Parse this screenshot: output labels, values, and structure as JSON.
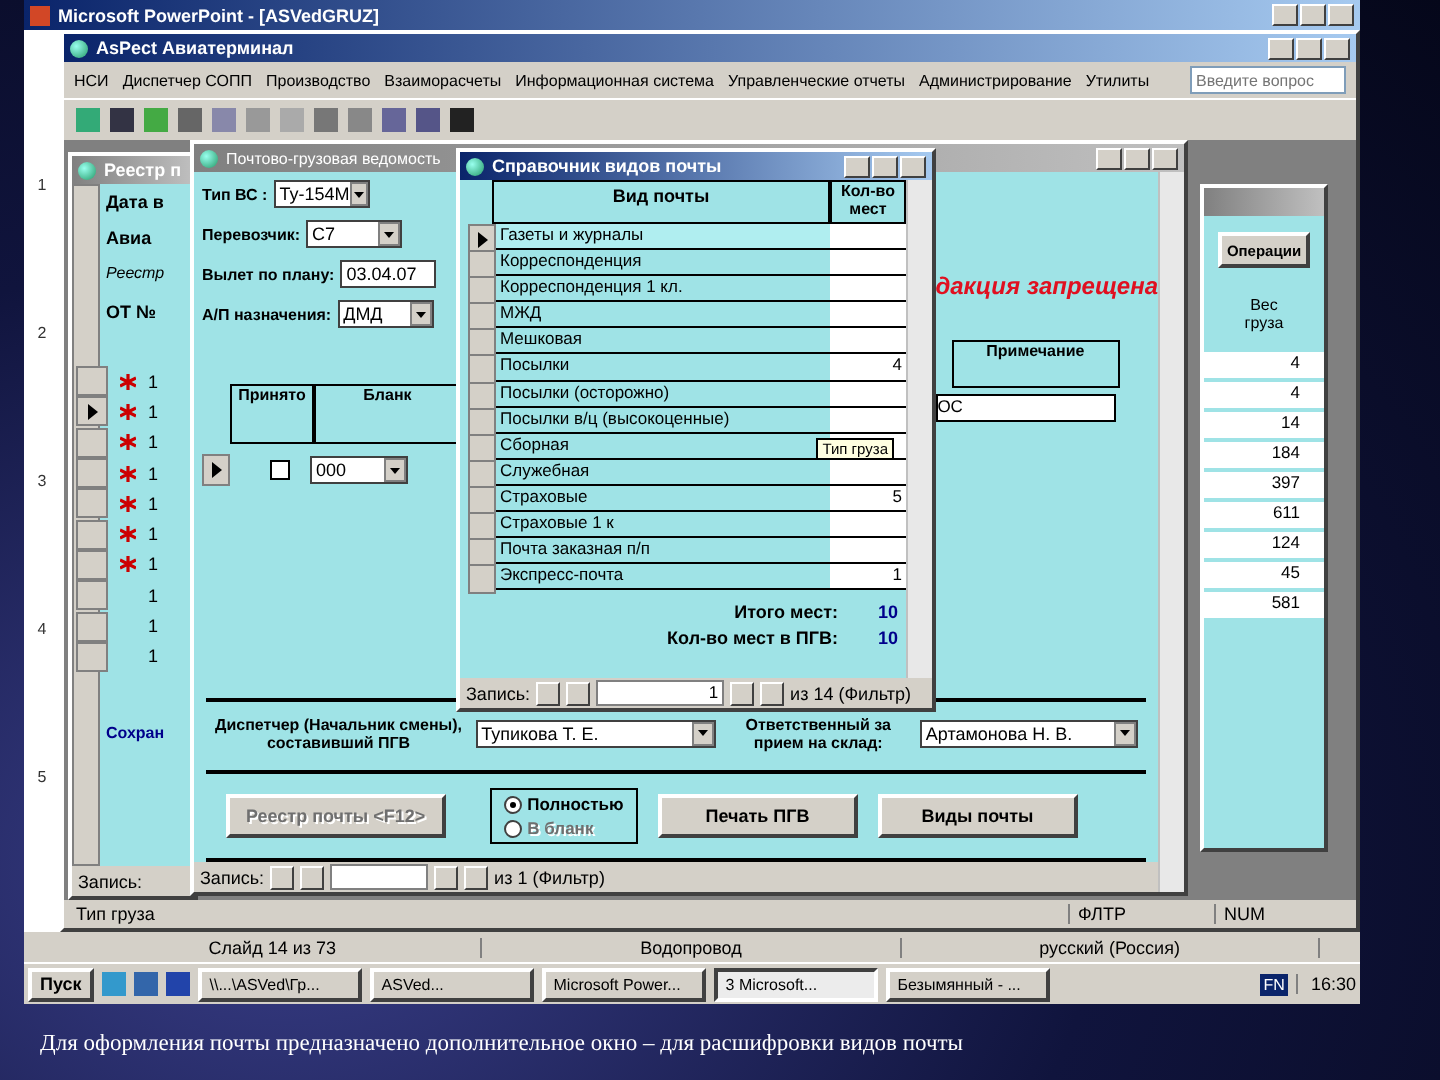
{
  "pp_window": {
    "title": "Microsoft PowerPoint - [ASVedGRUZ]"
  },
  "ruler": [
    "1",
    "2",
    "3",
    "4",
    "5"
  ],
  "app": {
    "title": "AsPect Авиатерминал",
    "menu": [
      "НСИ",
      "Диспетчер СОПП",
      "Производство",
      "Взаиморасчеты",
      "Информационная система",
      "Управленческие отчеты",
      "Администрирование",
      "Утилиты"
    ],
    "help_placeholder": "Введите вопрос"
  },
  "registry": {
    "title": "Реестр п",
    "labels": [
      "Дата в",
      "Авиа",
      "Реестр"
    ],
    "column": "ОТ №",
    "rows": [
      {
        "value": "1",
        "new": true,
        "selected": false
      },
      {
        "value": "1",
        "new": true,
        "selected": true
      },
      {
        "value": "1",
        "new": true,
        "selected": false
      },
      {
        "value": "1",
        "new": true,
        "selected": false
      },
      {
        "value": "1",
        "new": true,
        "selected": false
      },
      {
        "value": "1",
        "new": true,
        "selected": false
      },
      {
        "value": "1",
        "new": true,
        "selected": false
      },
      {
        "value": "1",
        "new": false,
        "selected": false
      },
      {
        "value": "1",
        "new": false,
        "selected": false
      },
      {
        "value": "1",
        "new": false,
        "selected": false
      }
    ],
    "link": "Сохран",
    "nav_label": "Запись:"
  },
  "statement": {
    "title": "Почтово-грузовая ведомость",
    "fields": [
      {
        "label": "Тип ВС :",
        "value": "Ту-154М"
      },
      {
        "label": "Перевозчик:",
        "value": "С7"
      },
      {
        "label": "Вылет по плану:",
        "value": "03.04.07"
      },
      {
        "label": "А/П назначения:",
        "value": "ДМД"
      }
    ],
    "warning": "дакция запрещена",
    "columns": [
      "Принято",
      "Бланк",
      "Примечание"
    ],
    "row": {
      "accepted": false,
      "blank": "000",
      "note": "ОС"
    },
    "dispatcher_label": "Диспетчер (Начальник смены), составивший ПГВ",
    "dispatcher": "Тупикова Т. Е.",
    "receiver_label": "Ответственный за прием на склад:",
    "receiver": "Артамонова Н. В.",
    "buttons": [
      {
        "label": "Реестр почты <F12>",
        "disabled": true
      },
      {
        "label": "Печать ПГВ",
        "disabled": false
      },
      {
        "label": "Виды почты",
        "disabled": false
      }
    ],
    "print_options": [
      {
        "label": "Полностью",
        "selected": true,
        "disabled": false
      },
      {
        "label": "В бланк",
        "selected": false,
        "disabled": true
      }
    ],
    "nav": {
      "label": "Запись:",
      "total": "из 1 (Фильтр)"
    }
  },
  "mail_types": {
    "title": "Справочник видов почты",
    "columns": [
      "Вид почты",
      "Кол-во мест"
    ],
    "rows": [
      {
        "name": "Газеты и журналы",
        "count": "",
        "selected": true
      },
      {
        "name": "Корреспонденция",
        "count": "",
        "selected": false
      },
      {
        "name": "Корреспонденция 1 кл.",
        "count": "",
        "selected": false
      },
      {
        "name": "МЖД",
        "count": "",
        "selected": false
      },
      {
        "name": "Мешковая",
        "count": "",
        "selected": false
      },
      {
        "name": "Посылки",
        "count": "4",
        "selected": false
      },
      {
        "name": "Посылки (осторожно)",
        "count": "",
        "selected": false
      },
      {
        "name": "Посылки в/ц (высокоценные)",
        "count": "",
        "selected": false
      },
      {
        "name": "Сборная",
        "count": "",
        "selected": false
      },
      {
        "name": "Служебная",
        "count": "",
        "selected": false
      },
      {
        "name": "Страховые",
        "count": "5",
        "selected": false
      },
      {
        "name": "Страховые 1 к",
        "count": "",
        "selected": false
      },
      {
        "name": "Почта заказная п/п",
        "count": "",
        "selected": false
      },
      {
        "name": "Экспресс-почта",
        "count": "1",
        "selected": false
      }
    ],
    "tooltip": "Тип груза",
    "total_label": "Итого мест:",
    "total": "10",
    "ved_label": "Кол-во мест в ПГВ:",
    "ved_total": "10",
    "nav": {
      "label": "Запись:",
      "value": "1",
      "total": "из 14 (Фильтр)"
    }
  },
  "ops": {
    "button": "Операции",
    "column": "Вес груза",
    "values": [
      "4",
      "4",
      "14",
      "184",
      "397",
      "611",
      "124",
      "45",
      "581"
    ]
  },
  "status_bar": {
    "text": "Тип груза",
    "indicators": [
      "ФЛТР",
      "NUM"
    ]
  },
  "pp_status": [
    "Слайд 14 из 73",
    "Водопровод",
    "русский (Россия)"
  ],
  "taskbar": {
    "start": "Пуск",
    "tasks": [
      {
        "label": "\\\\...\\ASVed\\Гр...",
        "selected": false
      },
      {
        "label": "ASVed...",
        "selected": false
      },
      {
        "label": "Microsoft Power...",
        "selected": false
      },
      {
        "label": "3 Microsoft...",
        "selected": true
      },
      {
        "label": "Безымянный - ...",
        "selected": false
      }
    ],
    "lang": "FN",
    "time": "16:30"
  },
  "caption": "Для оформления почты предназначено дополнительное окно – для расшифровки видов почты"
}
